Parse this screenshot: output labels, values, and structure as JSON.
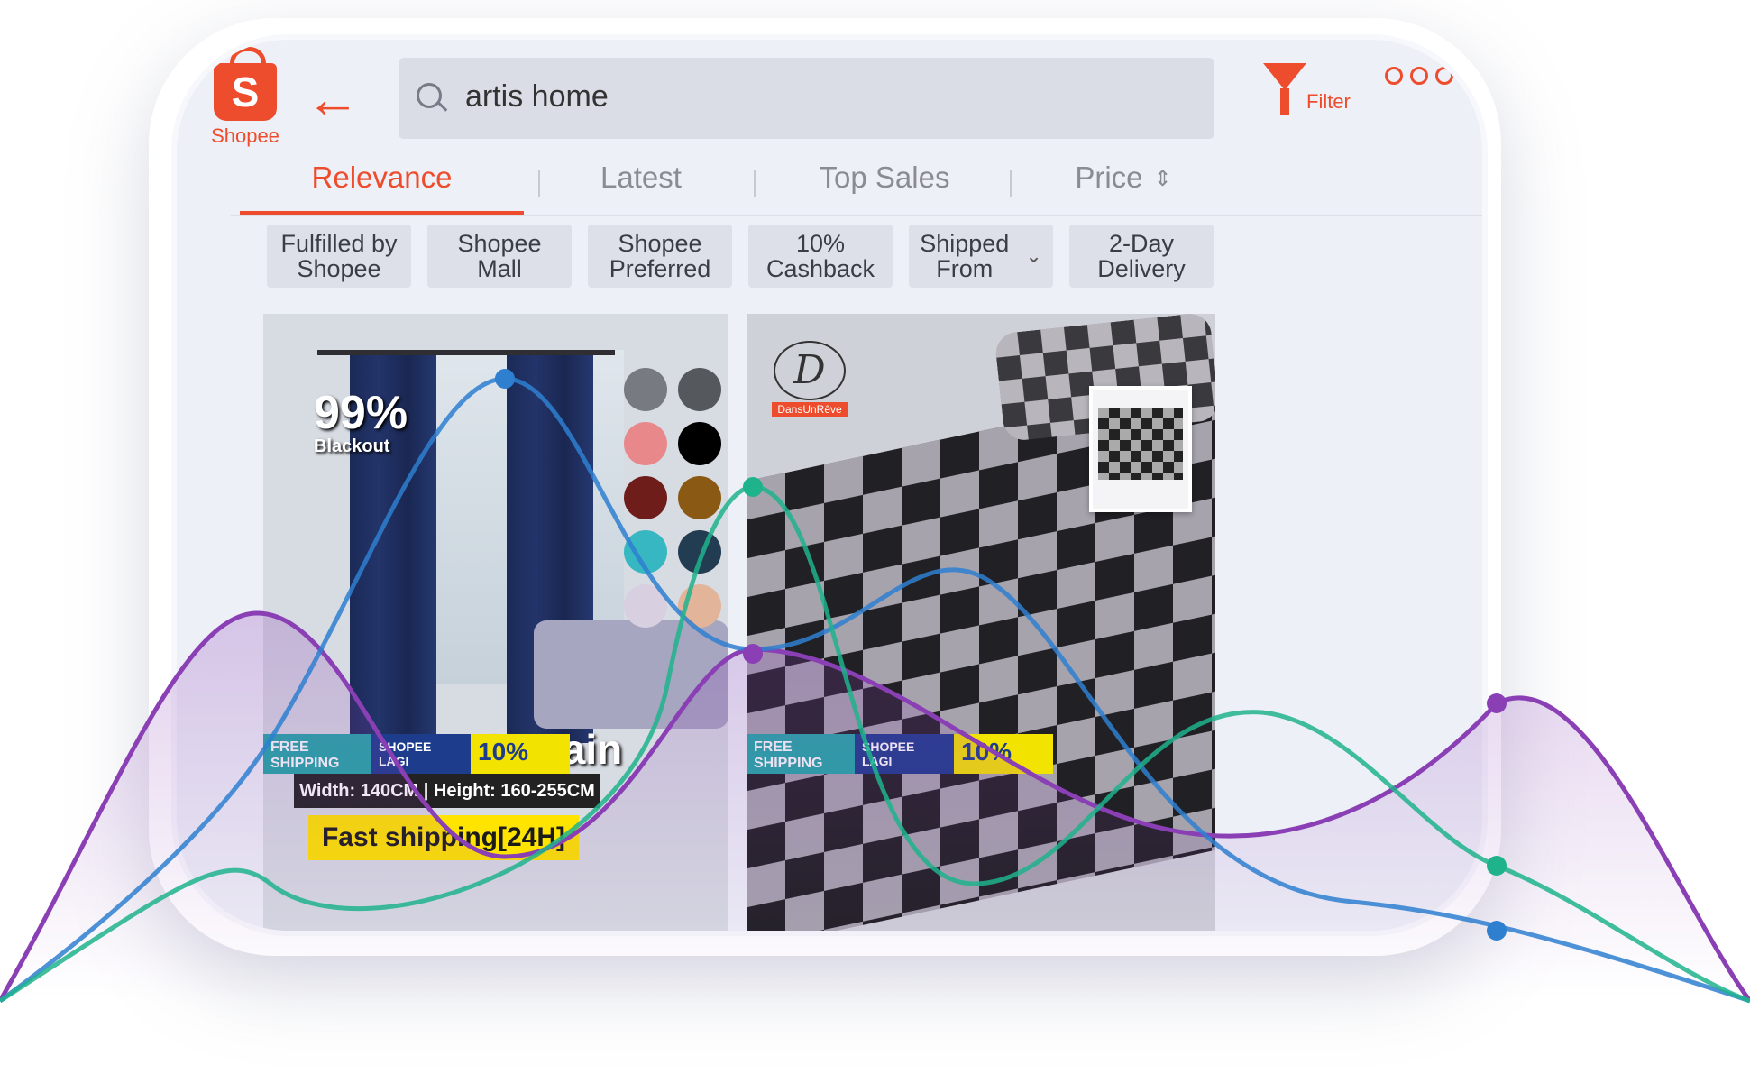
{
  "app": {
    "logo_text": "Shopee",
    "accent_color": "#ee4d2d"
  },
  "header": {
    "back_icon": "arrow-left-icon",
    "search_value": "artis home",
    "filter_label": "Filter",
    "more_icon": "more-dots-icon"
  },
  "tabs": [
    {
      "label": "Relevance",
      "active": true
    },
    {
      "label": "Latest",
      "active": false
    },
    {
      "label": "Top Sales",
      "active": false
    },
    {
      "label": "Price",
      "active": false,
      "icon": "sort-arrows-icon"
    }
  ],
  "chips": [
    {
      "line1": "Fulfilled by",
      "line2": "Shopee"
    },
    {
      "line1": "Shopee",
      "line2": "Mall"
    },
    {
      "line1": "Shopee",
      "line2": "Preferred"
    },
    {
      "line1": "10%",
      "line2": "Cashback"
    },
    {
      "line1": "Shipped",
      "line2": "From",
      "icon": "chevron-down-icon"
    },
    {
      "line1": "2-Day",
      "line2": "Delivery"
    }
  ],
  "products": [
    {
      "blackout_text": "99%",
      "blackout_sub": "Blackout",
      "title_overlay": "Grommet Curtain",
      "size_text": "Width: 140CM | Height: 160-255CM",
      "shipping_text": "Fast shipping[24H]",
      "badges": {
        "free": "FREE SHIPPING",
        "lagi": "SHOPEE LAGI",
        "cashback": "10%"
      }
    },
    {
      "brand_text": "DansUnRêve",
      "badges": {
        "free": "FREE SHIPPING",
        "lagi": "SHOPEE LAGI",
        "cashback": "10%"
      }
    }
  ],
  "decor": {
    "line_colors": [
      "#2e7fd0",
      "#1fb38c",
      "#8a3fb5"
    ]
  }
}
